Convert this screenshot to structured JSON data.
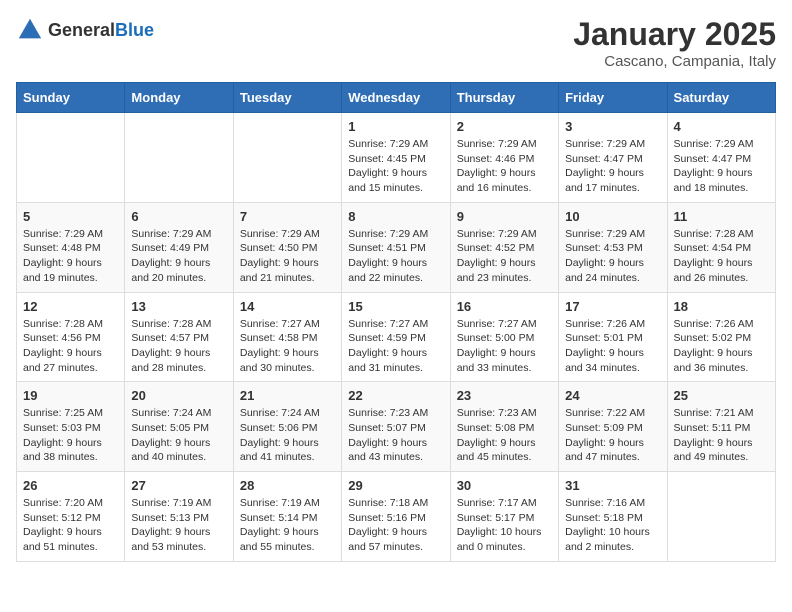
{
  "logo": {
    "general": "General",
    "blue": "Blue"
  },
  "header": {
    "month": "January 2025",
    "location": "Cascano, Campania, Italy"
  },
  "days_of_week": [
    "Sunday",
    "Monday",
    "Tuesday",
    "Wednesday",
    "Thursday",
    "Friday",
    "Saturday"
  ],
  "weeks": [
    [
      {
        "day": "",
        "info": ""
      },
      {
        "day": "",
        "info": ""
      },
      {
        "day": "",
        "info": ""
      },
      {
        "day": "1",
        "info": "Sunrise: 7:29 AM\nSunset: 4:45 PM\nDaylight: 9 hours\nand 15 minutes."
      },
      {
        "day": "2",
        "info": "Sunrise: 7:29 AM\nSunset: 4:46 PM\nDaylight: 9 hours\nand 16 minutes."
      },
      {
        "day": "3",
        "info": "Sunrise: 7:29 AM\nSunset: 4:47 PM\nDaylight: 9 hours\nand 17 minutes."
      },
      {
        "day": "4",
        "info": "Sunrise: 7:29 AM\nSunset: 4:47 PM\nDaylight: 9 hours\nand 18 minutes."
      }
    ],
    [
      {
        "day": "5",
        "info": "Sunrise: 7:29 AM\nSunset: 4:48 PM\nDaylight: 9 hours\nand 19 minutes."
      },
      {
        "day": "6",
        "info": "Sunrise: 7:29 AM\nSunset: 4:49 PM\nDaylight: 9 hours\nand 20 minutes."
      },
      {
        "day": "7",
        "info": "Sunrise: 7:29 AM\nSunset: 4:50 PM\nDaylight: 9 hours\nand 21 minutes."
      },
      {
        "day": "8",
        "info": "Sunrise: 7:29 AM\nSunset: 4:51 PM\nDaylight: 9 hours\nand 22 minutes."
      },
      {
        "day": "9",
        "info": "Sunrise: 7:29 AM\nSunset: 4:52 PM\nDaylight: 9 hours\nand 23 minutes."
      },
      {
        "day": "10",
        "info": "Sunrise: 7:29 AM\nSunset: 4:53 PM\nDaylight: 9 hours\nand 24 minutes."
      },
      {
        "day": "11",
        "info": "Sunrise: 7:28 AM\nSunset: 4:54 PM\nDaylight: 9 hours\nand 26 minutes."
      }
    ],
    [
      {
        "day": "12",
        "info": "Sunrise: 7:28 AM\nSunset: 4:56 PM\nDaylight: 9 hours\nand 27 minutes."
      },
      {
        "day": "13",
        "info": "Sunrise: 7:28 AM\nSunset: 4:57 PM\nDaylight: 9 hours\nand 28 minutes."
      },
      {
        "day": "14",
        "info": "Sunrise: 7:27 AM\nSunset: 4:58 PM\nDaylight: 9 hours\nand 30 minutes."
      },
      {
        "day": "15",
        "info": "Sunrise: 7:27 AM\nSunset: 4:59 PM\nDaylight: 9 hours\nand 31 minutes."
      },
      {
        "day": "16",
        "info": "Sunrise: 7:27 AM\nSunset: 5:00 PM\nDaylight: 9 hours\nand 33 minutes."
      },
      {
        "day": "17",
        "info": "Sunrise: 7:26 AM\nSunset: 5:01 PM\nDaylight: 9 hours\nand 34 minutes."
      },
      {
        "day": "18",
        "info": "Sunrise: 7:26 AM\nSunset: 5:02 PM\nDaylight: 9 hours\nand 36 minutes."
      }
    ],
    [
      {
        "day": "19",
        "info": "Sunrise: 7:25 AM\nSunset: 5:03 PM\nDaylight: 9 hours\nand 38 minutes."
      },
      {
        "day": "20",
        "info": "Sunrise: 7:24 AM\nSunset: 5:05 PM\nDaylight: 9 hours\nand 40 minutes."
      },
      {
        "day": "21",
        "info": "Sunrise: 7:24 AM\nSunset: 5:06 PM\nDaylight: 9 hours\nand 41 minutes."
      },
      {
        "day": "22",
        "info": "Sunrise: 7:23 AM\nSunset: 5:07 PM\nDaylight: 9 hours\nand 43 minutes."
      },
      {
        "day": "23",
        "info": "Sunrise: 7:23 AM\nSunset: 5:08 PM\nDaylight: 9 hours\nand 45 minutes."
      },
      {
        "day": "24",
        "info": "Sunrise: 7:22 AM\nSunset: 5:09 PM\nDaylight: 9 hours\nand 47 minutes."
      },
      {
        "day": "25",
        "info": "Sunrise: 7:21 AM\nSunset: 5:11 PM\nDaylight: 9 hours\nand 49 minutes."
      }
    ],
    [
      {
        "day": "26",
        "info": "Sunrise: 7:20 AM\nSunset: 5:12 PM\nDaylight: 9 hours\nand 51 minutes."
      },
      {
        "day": "27",
        "info": "Sunrise: 7:19 AM\nSunset: 5:13 PM\nDaylight: 9 hours\nand 53 minutes."
      },
      {
        "day": "28",
        "info": "Sunrise: 7:19 AM\nSunset: 5:14 PM\nDaylight: 9 hours\nand 55 minutes."
      },
      {
        "day": "29",
        "info": "Sunrise: 7:18 AM\nSunset: 5:16 PM\nDaylight: 9 hours\nand 57 minutes."
      },
      {
        "day": "30",
        "info": "Sunrise: 7:17 AM\nSunset: 5:17 PM\nDaylight: 10 hours\nand 0 minutes."
      },
      {
        "day": "31",
        "info": "Sunrise: 7:16 AM\nSunset: 5:18 PM\nDaylight: 10 hours\nand 2 minutes."
      },
      {
        "day": "",
        "info": ""
      }
    ]
  ]
}
